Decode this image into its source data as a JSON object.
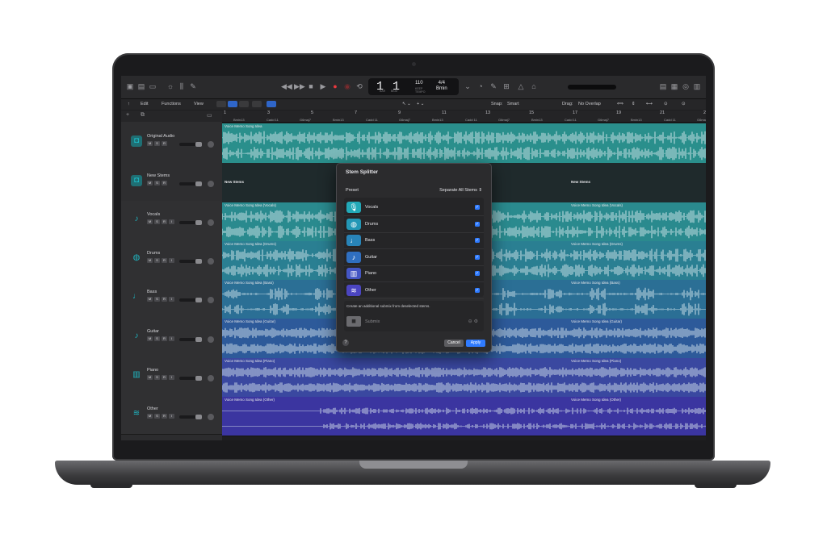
{
  "device": {
    "type": "laptop"
  },
  "control_bar": {
    "lcd_bar": "1",
    "lcd_beat": "1",
    "lcd_bar_sub": "BAR",
    "lcd_beat_sub": "BEAT",
    "tempo": "110",
    "tempo_sub": "KEEP",
    "tempo_sub2": "TEMPO",
    "time_signature": "4/4",
    "key": "Bmin"
  },
  "toolbar": {
    "edit": "Edit",
    "functions": "Functions",
    "view": "View",
    "snap_label": "Snap:",
    "snap_value": "Smart",
    "drag_label": "Drag:",
    "drag_value": "No Overlap"
  },
  "ruler": {
    "bars": [
      "1",
      "3",
      "5",
      "7",
      "9",
      "11",
      "13",
      "15",
      "17",
      "19",
      "21",
      "23"
    ],
    "chords": [
      "Bmin13",
      "Cadd 11",
      "G6maj7",
      "Bmin13",
      "Cadd 11",
      "G6maj7",
      "Bmin13",
      "Cadd 11",
      "G6maj7",
      "Bmin13",
      "Cadd 11",
      "G6maj7",
      "Bmin13",
      "Cadd 11",
      "G6maj7"
    ]
  },
  "tracks": [
    {
      "name": "Original Audio",
      "region": "Voice Memo Song Idea",
      "color": "#2a8f8c"
    },
    {
      "name": "New Stems",
      "region": "New Stems",
      "region_right": "New Stems",
      "color": "#1f2a2c"
    },
    {
      "name": "Vocals",
      "region": "Voice Memo Song Idea (Vocals)",
      "color": "#2a8a8e"
    },
    {
      "name": "Drums",
      "region": "Voice Memo Song Idea (Drums)",
      "color": "#2a7f92"
    },
    {
      "name": "Bass",
      "region": "Voice Memo Song Idea (Bass)",
      "color": "#2b6f95"
    },
    {
      "name": "Guitar",
      "region": "Voice Memo Song Idea (Guitar)",
      "color": "#2d5a9a"
    },
    {
      "name": "Piano",
      "region": "Voice Memo Song Idea (Piano)",
      "color": "#3a48a0"
    },
    {
      "name": "Other",
      "region": "Voice Memo Song Idea (Other)",
      "color": "#3b35a0"
    }
  ],
  "msr": {
    "m": "M",
    "s": "S",
    "r": "R",
    "i": "I"
  },
  "dialog": {
    "title": "Stem Splitter",
    "preset_label": "Preset",
    "preset_value": "Separate All Stems",
    "stems": [
      {
        "label": "Vocals",
        "checked": true,
        "icon": "microphone-icon",
        "color": "#22a9b8"
      },
      {
        "label": "Drums",
        "checked": true,
        "icon": "drum-icon",
        "color": "#2397b6"
      },
      {
        "label": "Bass",
        "checked": true,
        "icon": "bass-guitar-icon",
        "color": "#2884b8"
      },
      {
        "label": "Guitar",
        "checked": true,
        "icon": "guitar-icon",
        "color": "#2f6fc0"
      },
      {
        "label": "Piano",
        "checked": true,
        "icon": "piano-icon",
        "color": "#4456c4"
      },
      {
        "label": "Other",
        "checked": true,
        "icon": "waveform-icon",
        "color": "#4b45c0"
      }
    ],
    "submix_note": "Create an additional submix from deselected stems.",
    "submix_placeholder": "Submix",
    "help": "?",
    "cancel": "Cancel",
    "apply": "Apply"
  }
}
